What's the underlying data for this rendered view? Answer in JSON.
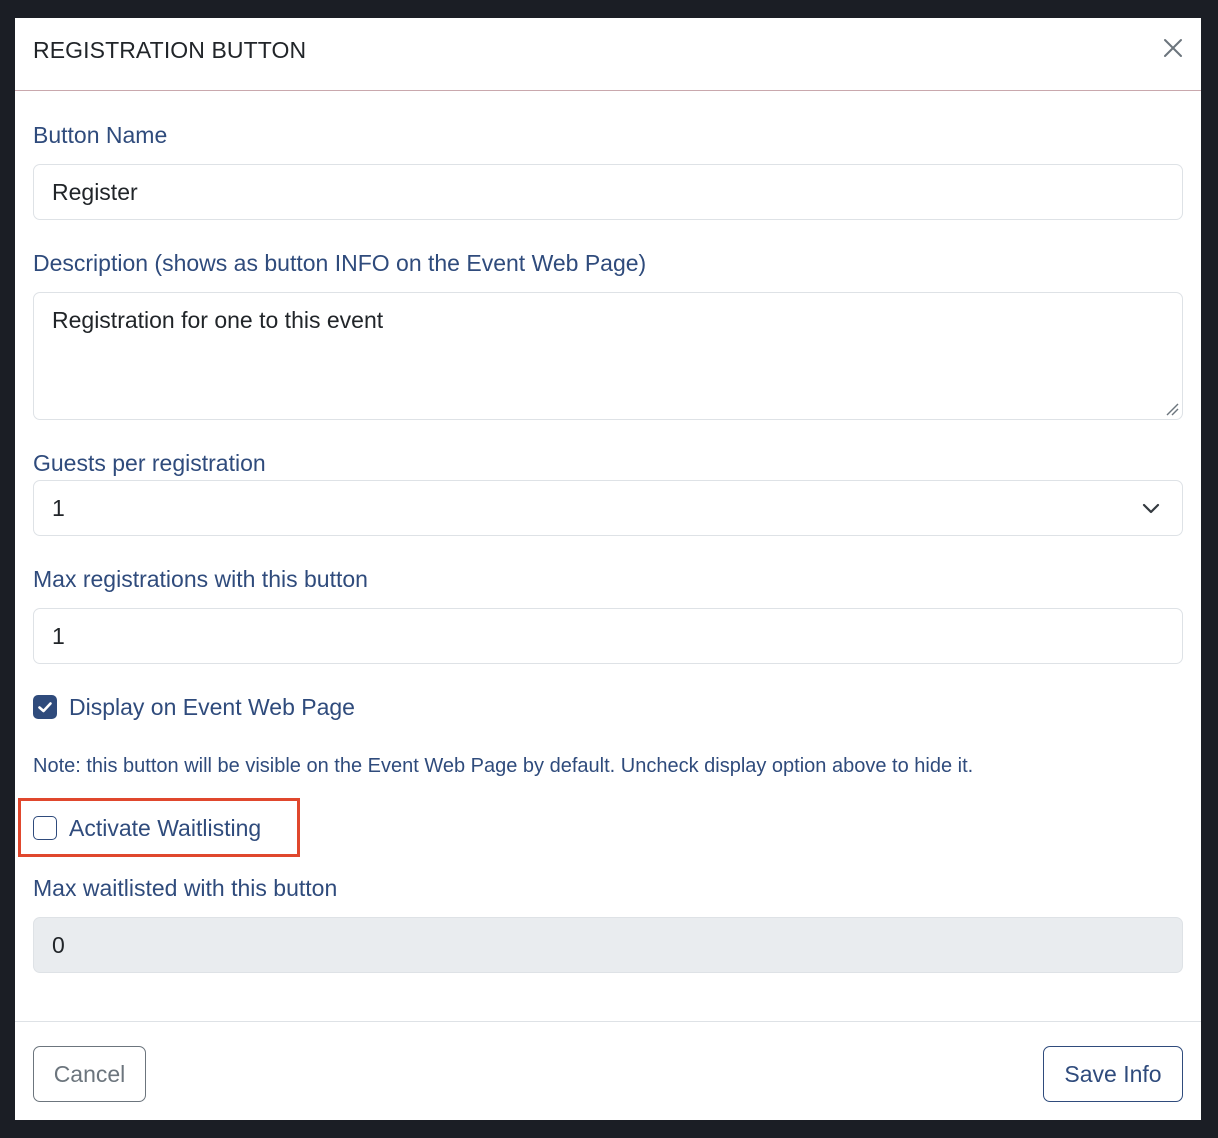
{
  "modal": {
    "title": "REGISTRATION BUTTON"
  },
  "form": {
    "button_name": {
      "label": "Button Name",
      "value": "Register"
    },
    "description": {
      "label": "Description (shows as button INFO on the Event Web Page)",
      "value": "Registration for one to this event"
    },
    "guests_per_registration": {
      "label": "Guests per registration",
      "selected": "1"
    },
    "max_registrations": {
      "label": "Max registrations with this button",
      "value": "1"
    },
    "display_on_event_page": {
      "label": "Display on Event Web Page",
      "checked": true
    },
    "note": "Note: this button will be visible on the Event Web Page by default. Uncheck display option above to hide it.",
    "activate_waitlisting": {
      "label": "Activate Waitlisting",
      "checked": false
    },
    "max_waitlisted": {
      "label": "Max waitlisted with this button",
      "value": "0",
      "disabled": true
    }
  },
  "footer": {
    "cancel_label": "Cancel",
    "save_label": "Save Info"
  },
  "colors": {
    "accent": "#2f4b7c",
    "highlight": "#e0472d",
    "disabled_bg": "#e9ecef"
  },
  "icons": {
    "close": "close-icon",
    "chevron": "chevron-down-icon",
    "check": "checkmark-icon",
    "resize": "resize-grip-icon"
  }
}
